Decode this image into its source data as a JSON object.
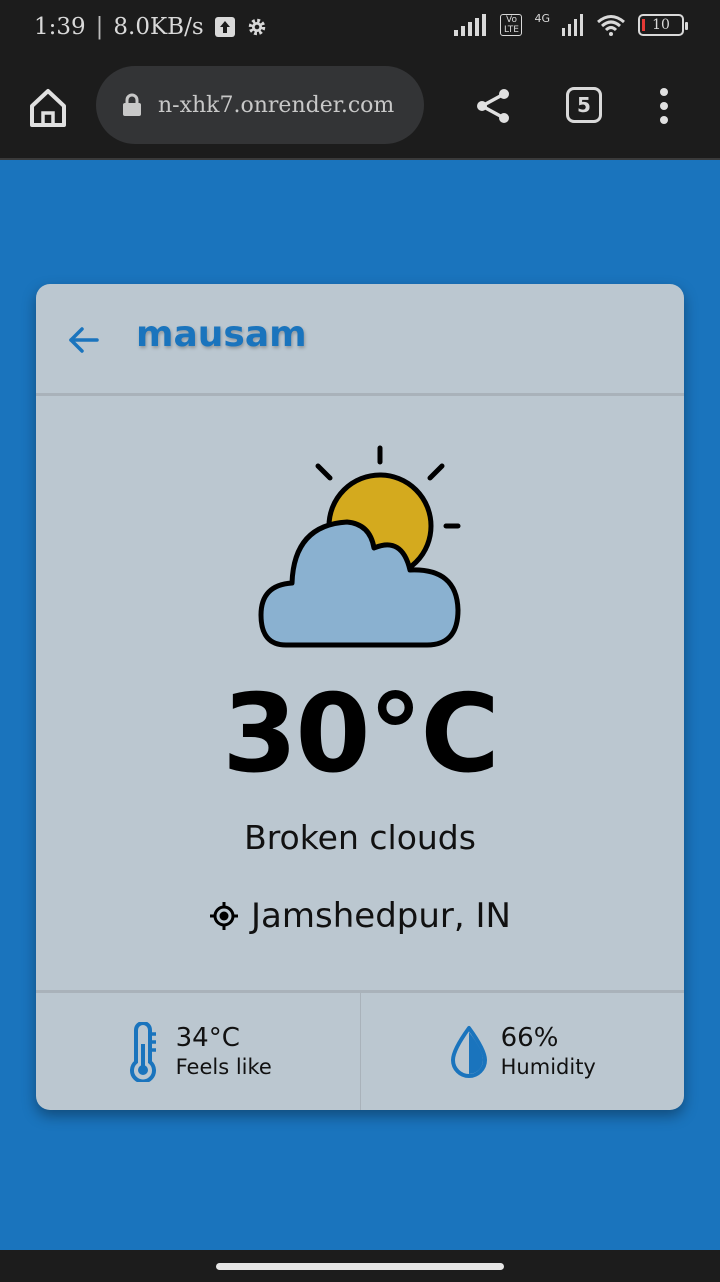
{
  "status_bar": {
    "time": "1:39",
    "separator": "|",
    "speed": "8.0KB/s",
    "network": "4G",
    "volte": "Vo LTE",
    "battery": "10"
  },
  "browser": {
    "url": "n-xhk7.onrender.com",
    "tab_count": "5"
  },
  "app": {
    "title": "mausam",
    "temperature": "30°C",
    "condition": "Broken clouds",
    "location": "Jamshedpur, IN",
    "feels_like": {
      "value": "34°C",
      "label": "Feels like"
    },
    "humidity": {
      "value": "66%",
      "label": "Humidity"
    }
  },
  "colors": {
    "background": "#1a74bd",
    "card": "#bbc7d0",
    "accent": "#1a74bd",
    "sun": "#d4aa1e",
    "cloud": "#8ab1d0"
  },
  "icons": {
    "back": "arrow-left-icon",
    "weather": "sun-behind-cloud-icon",
    "location": "crosshair-location-icon",
    "feels_like": "thermometer-icon",
    "humidity": "water-drop-icon"
  }
}
